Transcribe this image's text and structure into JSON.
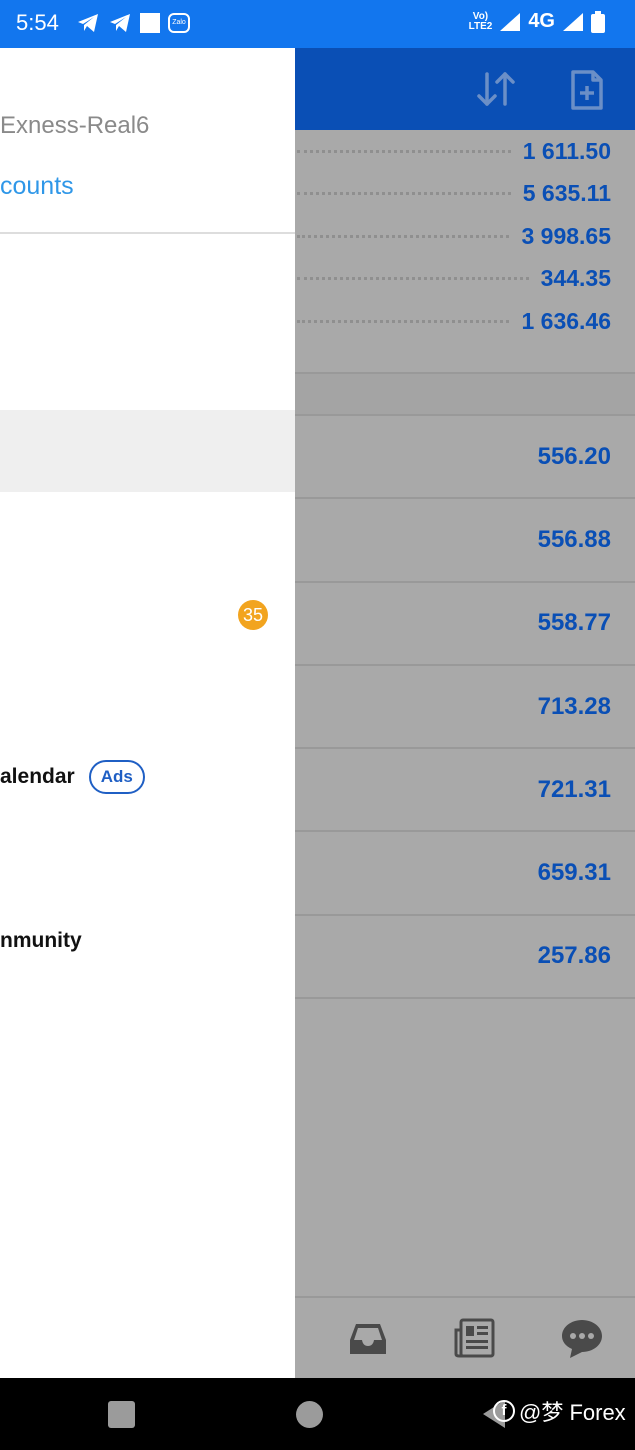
{
  "status_bar": {
    "time": "5:54",
    "zalo_label": "Zalo",
    "volte_label": "Vo)\nLTE2",
    "network": "4G"
  },
  "summary": {
    "values": [
      "1 611.50",
      "5 635.11",
      "3 998.65",
      "344.35",
      "1 636.46"
    ]
  },
  "positions": {
    "values": [
      "556.20",
      "556.88",
      "558.77",
      "713.28",
      "721.31",
      "659.31",
      "257.86"
    ]
  },
  "drawer": {
    "server": "Exness-Real6",
    "accounts_link": "counts",
    "items": [
      {
        "label": "alendar",
        "badge": "Ads"
      },
      {
        "label": "nmunity"
      }
    ],
    "notification_count": "35"
  },
  "watermark": {
    "fb": "f",
    "text": "@梦 Forex"
  },
  "colors": {
    "status_bar": "#1276ee",
    "toolbar": "#0a4fb5",
    "value_text": "#0a4fb5",
    "accounts_link": "#2f97e8",
    "badge": "#f2a41f"
  },
  "icons": [
    "telegram-icon",
    "square-notification-icon",
    "zalo-icon",
    "signal-icon",
    "battery-icon",
    "sort-icon",
    "new-order-icon",
    "inbox-icon",
    "news-icon",
    "chat-icon"
  ]
}
